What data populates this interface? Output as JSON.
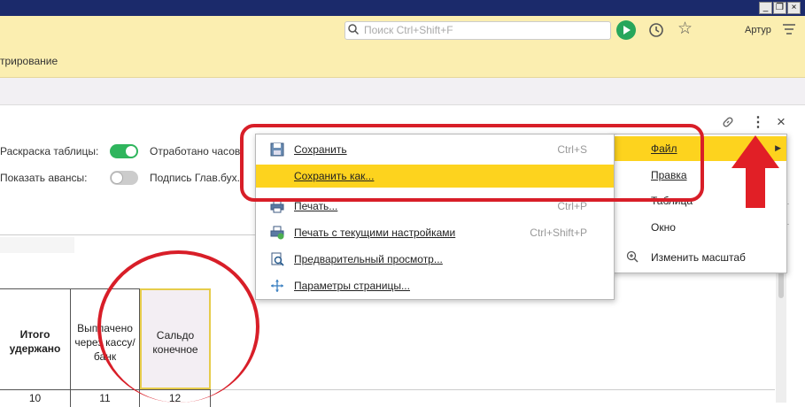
{
  "window": {
    "minimize": "_",
    "restore": "❐",
    "close": "×"
  },
  "topbar": {
    "search_placeholder": "Поиск Ctrl+Shift+F",
    "user": "Артур"
  },
  "section": {
    "label": "трирование"
  },
  "options": {
    "coloring_label": "Раскраска таблицы:",
    "coloring_on": true,
    "show_advances_label": "Показать авансы:",
    "show_advances_on": false,
    "worked_hours_label": "Отработано часов:",
    "signature_label": "Подпись Глав.бух.:"
  },
  "table": {
    "headers": [
      "Итого удержано",
      "Выплачено через кассу/банк",
      "Сальдо конечное"
    ],
    "numbers": [
      "10",
      "11",
      "12"
    ]
  },
  "panel_icons": {
    "link": "link-icon",
    "more": "⋮",
    "close": "×"
  },
  "main_menu": [
    {
      "label": "Файл",
      "highlighted": true
    },
    {
      "label": "Правка"
    },
    {
      "label": "Таблица"
    },
    {
      "label": "Окно"
    },
    {
      "label": "Изменить масштаб"
    }
  ],
  "file_submenu": [
    {
      "label": "Сохранить",
      "shortcut": "Ctrl+S"
    },
    {
      "label": "Сохранить как...",
      "shortcut": "",
      "highlighted": true
    },
    {
      "label": "Печать...",
      "shortcut": "Ctrl+P"
    },
    {
      "label": "Печать с текущими настройками",
      "shortcut": "Ctrl+Shift+P"
    },
    {
      "label": "Предварительный просмотр...",
      "shortcut": ""
    },
    {
      "label": "Параметры страницы...",
      "shortcut": ""
    }
  ],
  "colors": {
    "accent_yellow": "#fdd31e",
    "annotation_red": "#d81e28",
    "toggle_green": "#2fb55d"
  }
}
